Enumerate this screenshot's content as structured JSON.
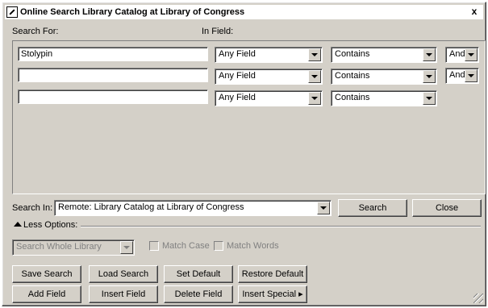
{
  "window": {
    "title": "Online Search Library Catalog at Library of Congress",
    "close_glyph": "x"
  },
  "labels": {
    "search_for": "Search For:",
    "in_field": "In Field:",
    "search_in": "Search In:",
    "less_options": "Less Options:"
  },
  "rows": [
    {
      "term": "Stolypin",
      "field": "Any Field",
      "match": "Contains",
      "bool": "And"
    },
    {
      "term": "",
      "field": "Any Field",
      "match": "Contains",
      "bool": "And"
    },
    {
      "term": "",
      "field": "Any Field",
      "match": "Contains"
    }
  ],
  "search_in": {
    "value": "Remote: Library Catalog at Library of Congress",
    "search_button": "Search",
    "close_button": "Close"
  },
  "options": {
    "scope": "Search Whole Library",
    "match_case": "Match Case",
    "match_words": "Match Words"
  },
  "buttons": {
    "save_search": "Save Search",
    "load_search": "Load Search",
    "set_default": "Set Default",
    "restore_default": "Restore Default",
    "add_field": "Add Field",
    "insert_field": "Insert Field",
    "delete_field": "Delete Field",
    "insert_special": "Insert Special ▸"
  }
}
